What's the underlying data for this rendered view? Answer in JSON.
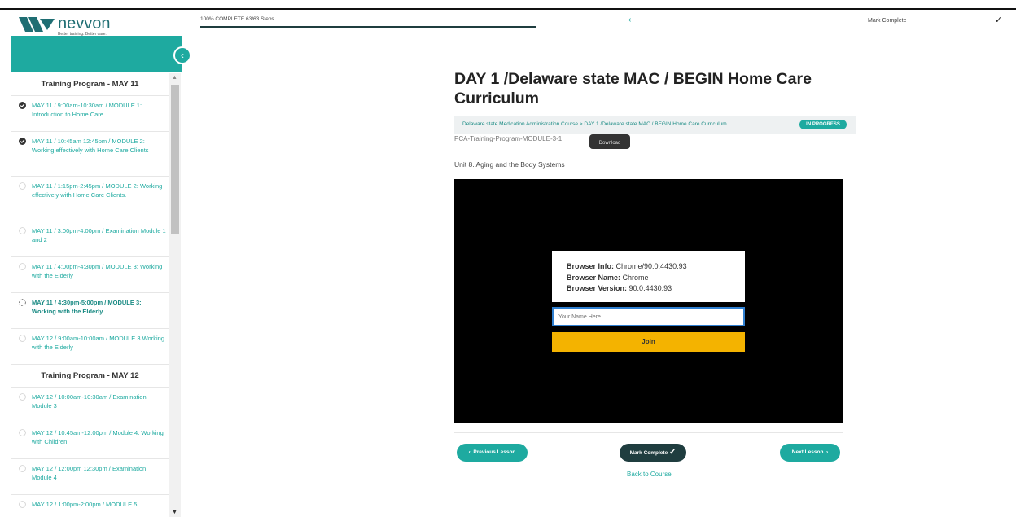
{
  "brand": {
    "name": "nevvon",
    "tagline": "Better training. Better care."
  },
  "colors": {
    "teal": "#1eaaa0",
    "dark": "#1f3d3f",
    "join": "#f4b300"
  },
  "sidebar": {
    "sections": [
      {
        "title": "Training Program - MAY 11",
        "items": [
          {
            "label": "MAY 11 / 9:00am-10:30am / MODULE 1: Introduction to Home Care",
            "status": "complete"
          },
          {
            "label": "MAY 11 / 10:45am 12:45pm / MODULE 2: Working effectively with Home Care Clients",
            "status": "complete"
          },
          {
            "label": "MAY 11 / 1:15pm-2:45pm / MODULE 2: Working effectively with Home Care Clients.",
            "status": "incomplete"
          },
          {
            "label": "MAY 11 / 3:00pm-4:00pm / Examination Module 1 and 2",
            "status": "incomplete"
          },
          {
            "label": "MAY 11 / 4:00pm-4:30pm / MODULE 3: Working with the Elderly",
            "status": "incomplete"
          },
          {
            "label": "MAY 11 / 4:30pm-5:00pm / MODULE 3: Working with the Elderly",
            "status": "current"
          },
          {
            "label": "MAY 12 / 9:00am-10:00am / MODULE 3 Working with the Elderly",
            "status": "incomplete"
          }
        ]
      },
      {
        "title": "Training Program - MAY 12",
        "items": [
          {
            "label": "MAY 12 / 10:00am-10:30am / Examination Module 3",
            "status": "incomplete"
          },
          {
            "label": "MAY 12 / 10:45am-12:00pm / Module 4. Working with Chlidren",
            "status": "incomplete"
          },
          {
            "label": "MAY 12 / 12:00pm 12:30pm / Examination Module 4",
            "status": "incomplete"
          },
          {
            "label": "MAY 12 / 1:00pm-2:00pm / MODULE 5:",
            "status": "incomplete"
          }
        ]
      }
    ]
  },
  "topbar": {
    "progress_text": "100% COMPLETE 63/63 Steps",
    "progress": 1.0,
    "mark_complete": "Mark Complete"
  },
  "lesson": {
    "title": "DAY 1 /Delaware state MAC / BEGIN Home Care Curriculum",
    "breadcrumb": "Delaware state Medication Administration Course > DAY 1 /Delaware state MAC / BEGIN Home Care Curriculum",
    "status": "IN PROGRESS",
    "subheading": "PCA-Training-Program-MODULE-3-1",
    "download": "Download",
    "unit": "Unit 8. Aging and the Body Systems"
  },
  "video": {
    "browser_info_label": "Browser Info:",
    "browser_info": "Chrome/90.0.4430.93",
    "browser_name_label": "Browser Name:",
    "browser_name": "Chrome",
    "browser_version_label": "Browser Version:",
    "browser_version": "90.0.4430.93",
    "name_placeholder": "Your Name Here",
    "join": "Join"
  },
  "nav": {
    "previous": "Previous Lesson",
    "mark_complete": "Mark Complete",
    "next": "Next Lesson",
    "back": "Back to Course"
  }
}
